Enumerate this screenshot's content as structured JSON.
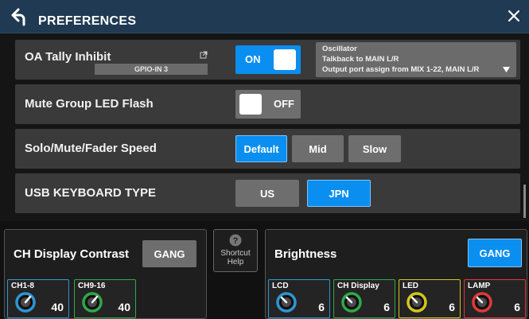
{
  "header": {
    "title": "PREFERENCES"
  },
  "rows": {
    "oa_tally": {
      "label": "OA Tally Inhibit",
      "gpio": "GPIO-IN 3",
      "toggle_text": "ON",
      "dropdown": {
        "line1": "Oscillator",
        "line2": "Talkback to MAIN L/R",
        "line3": "Output port assign from MIX 1-22, MAIN L/R"
      }
    },
    "mute_group": {
      "label": "Mute Group LED Flash",
      "toggle_text": "OFF"
    },
    "speed": {
      "label": "Solo/Mute/Fader Speed",
      "options": [
        "Default",
        "Mid",
        "Slow"
      ]
    },
    "keyboard": {
      "label": "USB KEYBOARD TYPE",
      "options": [
        "US",
        "JPN"
      ]
    }
  },
  "shortcut": {
    "line1": "Shortcut",
    "line2": "Help"
  },
  "ch_contrast": {
    "title": "CH Display Contrast",
    "gang_label": "GANG",
    "knobs": [
      {
        "label": "CH1-8",
        "value": "40",
        "color": "#2e95d3"
      },
      {
        "label": "CH9-16",
        "value": "40",
        "color": "#2fa84a"
      }
    ]
  },
  "brightness": {
    "title": "Brightness",
    "gang_label": "GANG",
    "knobs": [
      {
        "label": "LCD",
        "value": "6",
        "color": "#2e95d3"
      },
      {
        "label": "CH Display",
        "value": "6",
        "color": "#2fa84a"
      },
      {
        "label": "LED",
        "value": "6",
        "color": "#d6c51c"
      },
      {
        "label": "LAMP",
        "value": "6",
        "color": "#e03a3a"
      }
    ]
  }
}
